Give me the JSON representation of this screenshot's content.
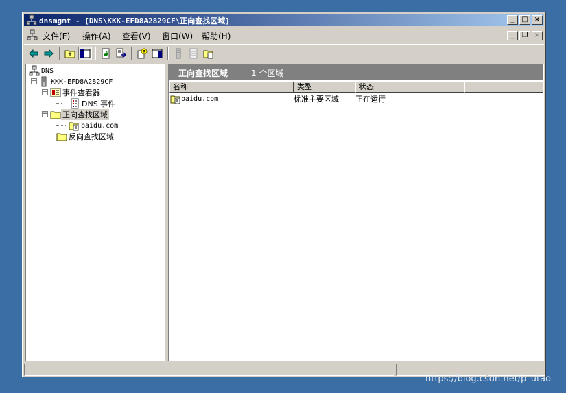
{
  "window": {
    "title": "dnsmgmt - [DNS\\KKK-EFD8A2829CF\\正向查找区域]",
    "controls": {
      "minimize": "_",
      "maximize": "□",
      "close": "×"
    }
  },
  "menubar": {
    "items": [
      {
        "label": "文件(F)"
      },
      {
        "label": "操作(A)"
      },
      {
        "label": "查看(V)"
      },
      {
        "label": "窗口(W)"
      },
      {
        "label": "帮助(H)"
      }
    ],
    "mdi_controls": {
      "minimize": "_",
      "restore": "❐",
      "close": "×"
    }
  },
  "toolbar": {
    "buttons": [
      "back-icon",
      "forward-icon",
      "up-folder-icon",
      "show-tree-icon",
      "refresh-icon",
      "export-icon",
      "help-icon",
      "console-icon",
      "server-icon",
      "record-icon",
      "zone-icon"
    ]
  },
  "tree": {
    "root": "DNS",
    "server": "KKK-EFD8A2829CF",
    "event_viewer": "事件查看器",
    "dns_events": "DNS 事件",
    "forward_zones": "正向查找区域",
    "zone": "baidu.com",
    "reverse_zones": "反向查找区域"
  },
  "details": {
    "title": "正向查找区域",
    "count": "1 个区域",
    "columns": [
      "名称",
      "类型",
      "状态"
    ],
    "rows": [
      {
        "name": "baidu.com",
        "type": "标准主要区域",
        "status": "正在运行"
      }
    ]
  },
  "watermark": "https://blog.csdn.net/p_utao",
  "colors": {
    "desktop": "#3a6ea5",
    "title_start": "#0a246a",
    "title_end": "#a6caf0",
    "face": "#d4d0c8"
  }
}
